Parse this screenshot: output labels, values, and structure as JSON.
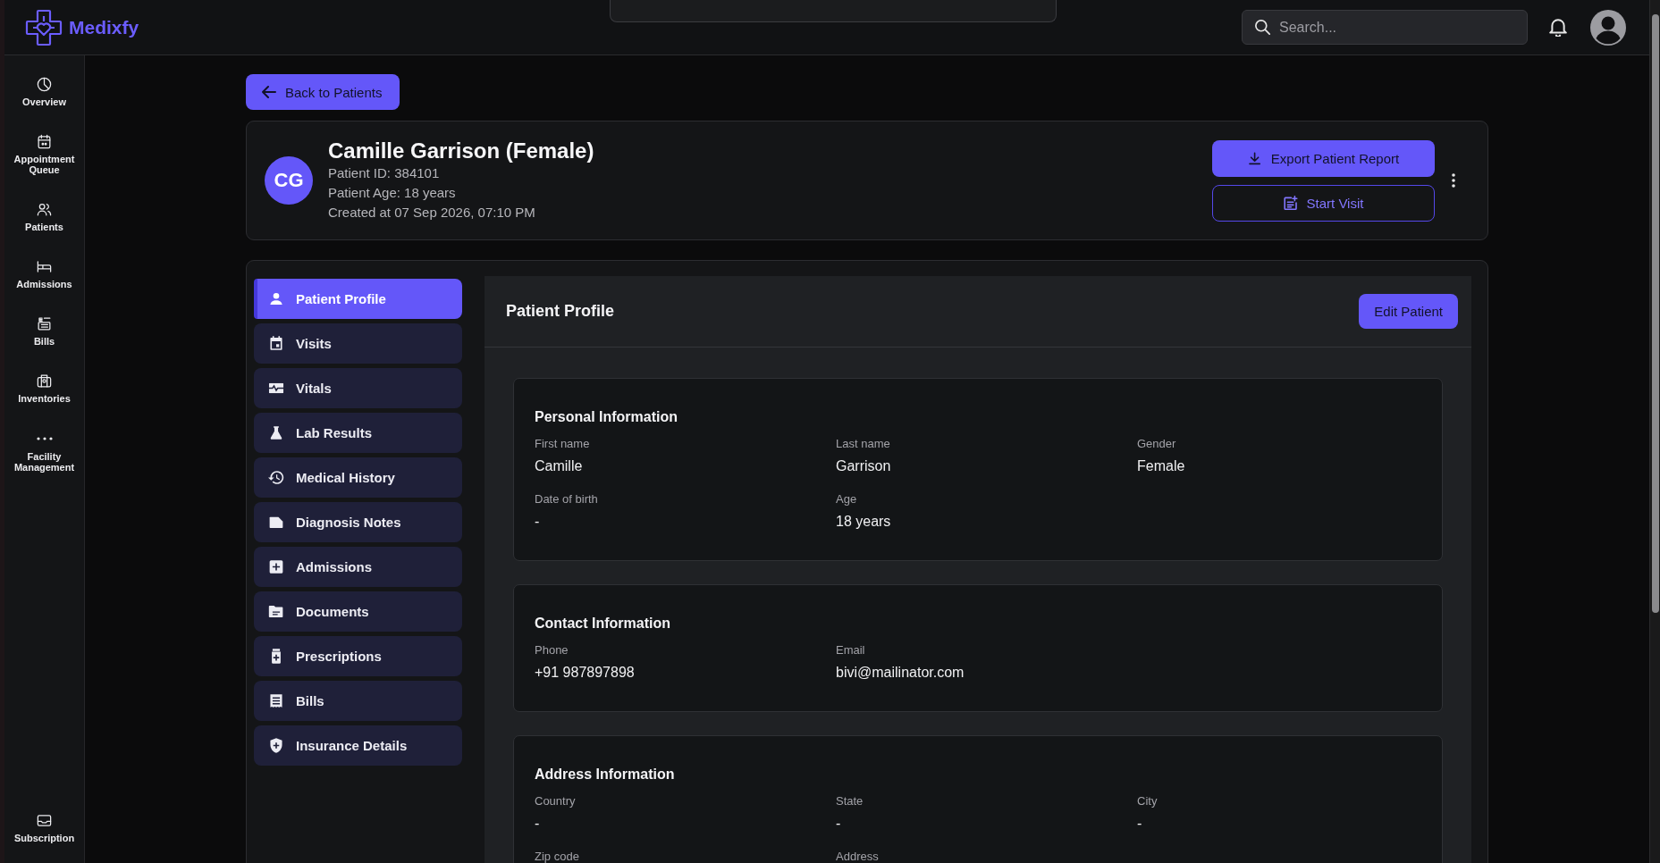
{
  "app": {
    "name": "Medixfy"
  },
  "search": {
    "placeholder": "Search..."
  },
  "nav": {
    "items": [
      {
        "label": "Overview",
        "selected": false
      },
      {
        "label": "Appointment Queue",
        "selected": false
      },
      {
        "label": "Patients",
        "selected": false
      },
      {
        "label": "Admissions",
        "selected": false
      },
      {
        "label": "Bills",
        "selected": false
      },
      {
        "label": "Inventories",
        "selected": false
      },
      {
        "label": "Facility Management",
        "selected": false
      }
    ],
    "footer": {
      "label": "Subscription",
      "selected": false
    }
  },
  "back_button": {
    "label": "Back to Patients"
  },
  "patient": {
    "initials": "CG",
    "name": "Camille Garrison (Female)",
    "details": [
      "Patient ID: 384101",
      "Patient Age: 18 years",
      "Created at 07 Sep 2026, 07:10 PM"
    ],
    "actions": [
      {
        "label": "Export Patient Report",
        "kind": "primary"
      },
      {
        "label": "Start Visit",
        "kind": "outline"
      }
    ]
  },
  "tabs": [
    {
      "label": "Patient Profile",
      "selected": true
    },
    {
      "label": "Visits",
      "selected": false
    },
    {
      "label": "Vitals",
      "selected": false
    },
    {
      "label": "Lab Results",
      "selected": false
    },
    {
      "label": "Medical History",
      "selected": false
    },
    {
      "label": "Diagnosis Notes",
      "selected": false
    },
    {
      "label": "Admissions",
      "selected": false
    },
    {
      "label": "Documents",
      "selected": false
    },
    {
      "label": "Prescriptions",
      "selected": false
    },
    {
      "label": "Bills",
      "selected": false
    },
    {
      "label": "Insurance Details",
      "selected": false
    }
  ],
  "panel": {
    "title": "Patient Profile",
    "edit_button": "Edit Patient",
    "sections": [
      {
        "title": "Personal Information",
        "fields": [
          {
            "label": "First name",
            "value": "Camille"
          },
          {
            "label": "Last name",
            "value": "Garrison"
          },
          {
            "label": "Gender",
            "value": "Female"
          },
          {
            "label": "Date of birth",
            "value": "-"
          },
          {
            "label": "Age",
            "value": "18 years"
          }
        ]
      },
      {
        "title": "Contact Information",
        "fields": [
          {
            "label": "Phone",
            "value": "+91 987897898"
          },
          {
            "label": "Email",
            "value": "bivi@mailinator.com"
          }
        ]
      },
      {
        "title": "Address Information",
        "fields": [
          {
            "label": "Country",
            "value": "-"
          },
          {
            "label": "State",
            "value": "-"
          },
          {
            "label": "City",
            "value": "-"
          },
          {
            "label": "Zip code"
          },
          {
            "label": "Address"
          }
        ]
      }
    ]
  }
}
